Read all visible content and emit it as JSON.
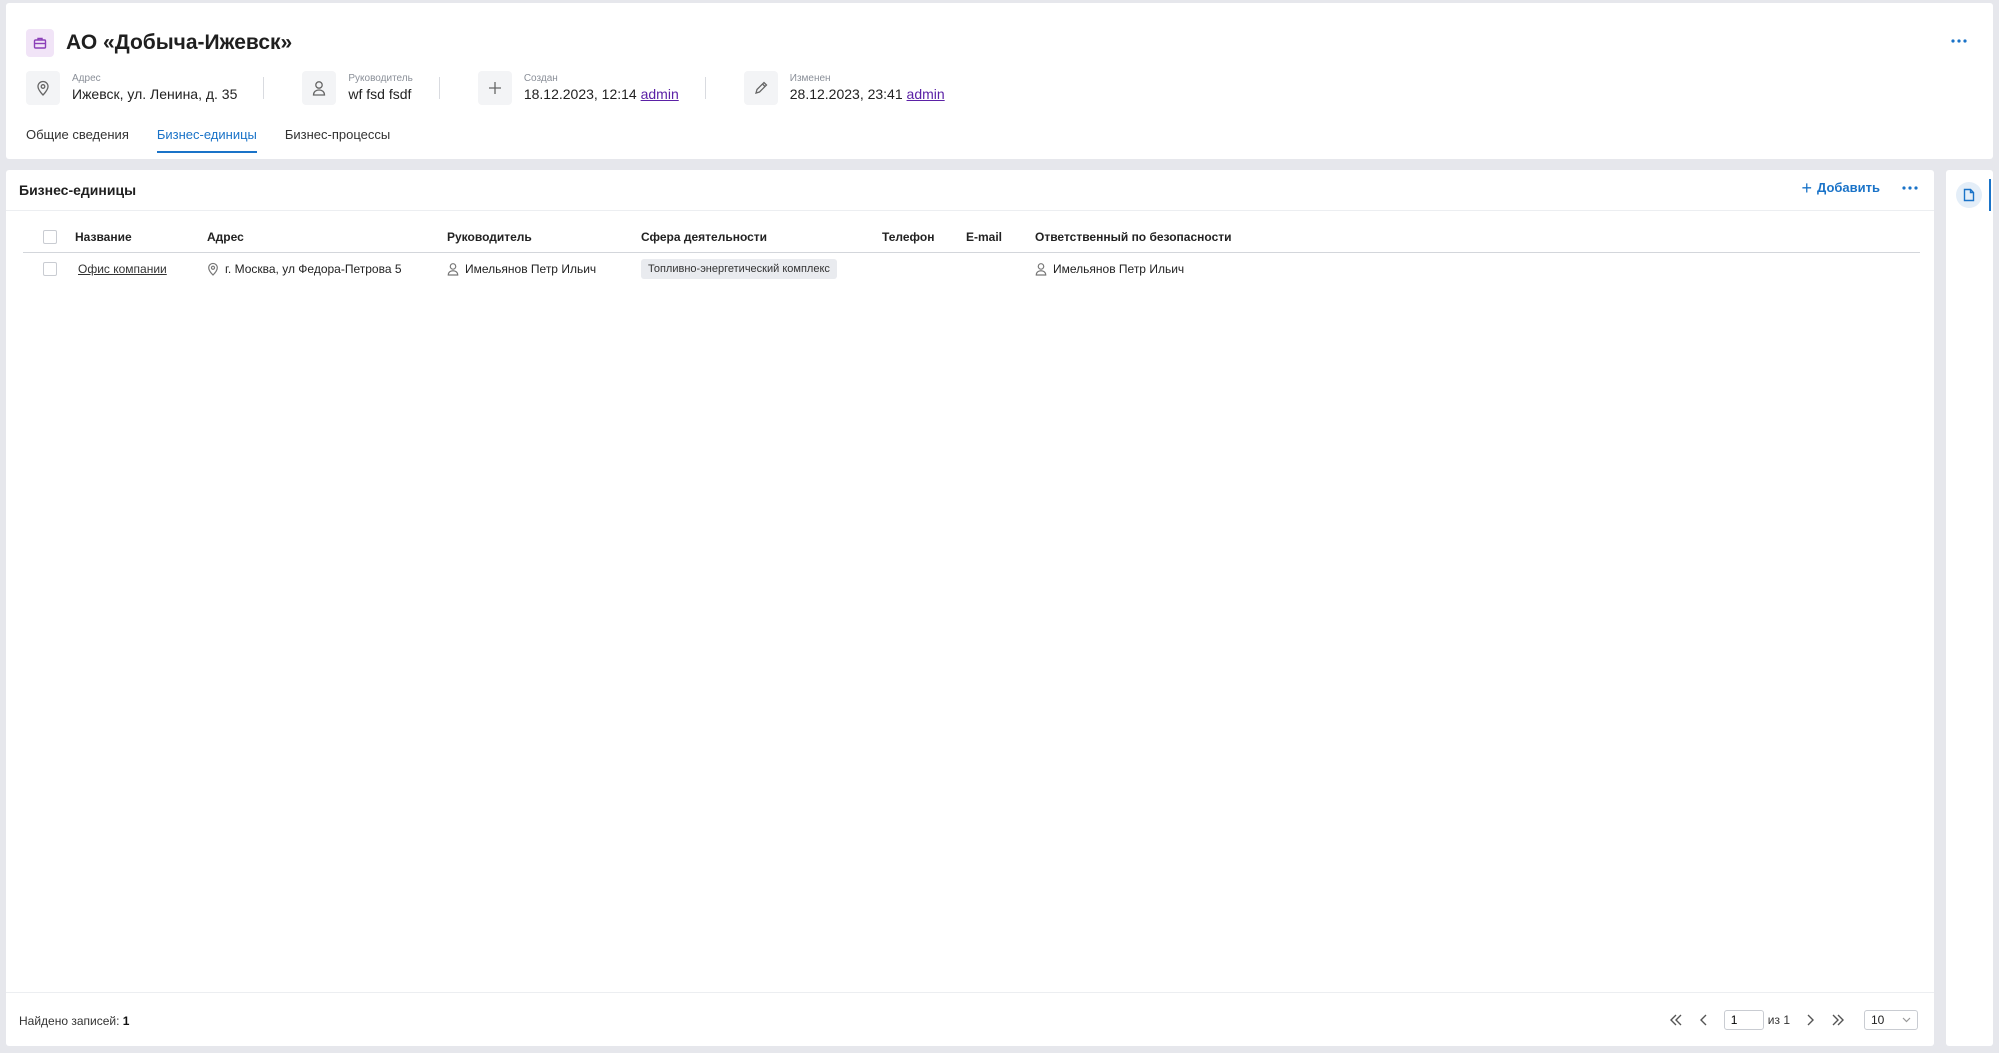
{
  "header": {
    "title": "АО «Добыча-Ижевск»",
    "meta": {
      "address": {
        "label": "Адрес",
        "value": "Ижевск, ул. Ленина, д. 35"
      },
      "manager": {
        "label": "Руководитель",
        "value": "wf fsd fsdf"
      },
      "created": {
        "label": "Создан",
        "value": "18.12.2023, 12:14",
        "user": "admin"
      },
      "modified": {
        "label": "Изменен",
        "value": "28.12.2023, 23:41",
        "user": "admin"
      }
    },
    "tabs": [
      {
        "label": "Общие сведения",
        "active": false
      },
      {
        "label": "Бизнес-единицы",
        "active": true
      },
      {
        "label": "Бизнес-процессы",
        "active": false
      }
    ]
  },
  "section": {
    "title": "Бизнес-единицы",
    "add_label": "Добавить"
  },
  "table": {
    "columns": [
      "Название",
      "Адрес",
      "Руководитель",
      "Сфера деятельности",
      "Телефон",
      "E-mail",
      "Ответственный по безопасности"
    ],
    "rows": [
      {
        "name": "Офис компании",
        "address": "г. Москва, ул Федора-Петрова 5",
        "manager": "Имельянов Петр Ильич",
        "sphere": "Топливно-энергетический комплекс",
        "phone": "",
        "email": "",
        "security": "Имельянов Петр Ильич"
      }
    ]
  },
  "footer": {
    "found_label": "Найдено записей:",
    "found_count": "1",
    "page": "1",
    "of_label": "из 1",
    "page_size": "10"
  },
  "colors": {
    "accent": "#1a73c8",
    "link_purple": "#5b21a6",
    "title_icon_bg": "#f1e4f7"
  }
}
